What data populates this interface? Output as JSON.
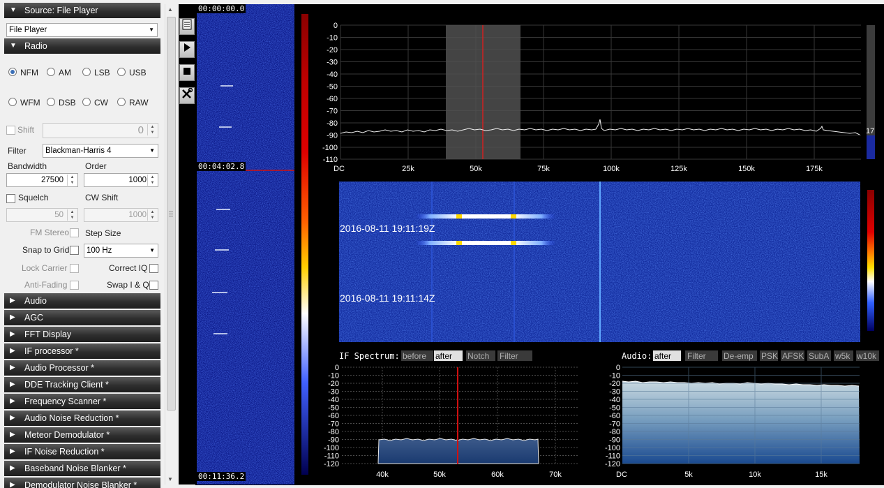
{
  "left_panel": {
    "source_header": "Source: File Player",
    "source_combo": "File Player",
    "radio_header": "Radio",
    "modes_row1": [
      "NFM",
      "AM",
      "LSB",
      "USB"
    ],
    "modes_row2": [
      "WFM",
      "DSB",
      "CW",
      "RAW"
    ],
    "selected_mode": "NFM",
    "shift_label": "Shift",
    "shift_value": "0",
    "filter_label": "Filter",
    "filter_value": "Blackman-Harris 4",
    "bandwidth_label": "Bandwidth",
    "bandwidth_value": "27500",
    "order_label": "Order",
    "order_value": "1000",
    "squelch_label": "Squelch",
    "squelch_value": "50",
    "cw_shift_label": "CW Shift",
    "cw_shift_value": "1000",
    "fm_stereo_label": "FM Stereo",
    "step_size_label": "Step Size",
    "snap_label": "Snap to Grid",
    "step_value": "100 Hz",
    "lock_carrier_label": "Lock Carrier",
    "correct_iq_label": "Correct IQ",
    "anti_fading_label": "Anti-Fading",
    "swap_iq_label": "Swap I & Q",
    "collapsed_sections": [
      "Audio",
      "AGC",
      "FFT Display",
      "IF processor *",
      "Audio Processor *",
      "DDE Tracking Client *",
      "Frequency Scanner *",
      "Audio Noise Reduction *",
      "Meteor Demodulator *",
      "IF Noise Reduction *",
      "Baseband Noise Blanker *",
      "Demodulator Noise Blanker *"
    ]
  },
  "vertical_waterfall": {
    "timestamps": [
      "00:00:00.0",
      "00:04:02.8",
      "00:11:36.2"
    ]
  },
  "main_spectrum": {
    "y_ticks": [
      "0",
      "-10",
      "-20",
      "-30",
      "-40",
      "-50",
      "-60",
      "-70",
      "-80",
      "-90",
      "-100",
      "-110"
    ],
    "x_ticks": [
      "DC",
      "25k",
      "50k",
      "75k",
      "100k",
      "125k",
      "150k",
      "175k"
    ],
    "level_value": "17",
    "colors": {
      "trace": "#ffffff",
      "center_line": "#d02020",
      "filter_band": "#4a4a4a",
      "grid": "#3a3a3a"
    }
  },
  "waterfall": {
    "timestamps": [
      "2016-08-11 19:11:19Z",
      "2016-08-11 19:11:14Z"
    ]
  },
  "if_spectrum": {
    "title": "IF Spectrum:",
    "tabs": [
      "before",
      "after",
      "Notch",
      "Filter"
    ],
    "active_tab": "after",
    "y_ticks": [
      "0",
      "-10",
      "-20",
      "-30",
      "-40",
      "-50",
      "-60",
      "-70",
      "-80",
      "-90",
      "-100",
      "-110",
      "-120"
    ],
    "x_ticks": [
      "40k",
      "50k",
      "60k",
      "70k"
    ]
  },
  "audio_spectrum": {
    "title": "Audio:",
    "tabs": [
      "after",
      "Filter",
      "De-emp",
      "PSK",
      "AFSK",
      "SubA",
      "w5k",
      "w10k"
    ],
    "active_tab": "after",
    "y_ticks": [
      "0",
      "-10",
      "-20",
      "-30",
      "-40",
      "-50",
      "-60",
      "-70",
      "-80",
      "-90",
      "-100",
      "-110",
      "-120"
    ],
    "x_ticks": [
      "DC",
      "5k",
      "10k",
      "15k"
    ]
  }
}
